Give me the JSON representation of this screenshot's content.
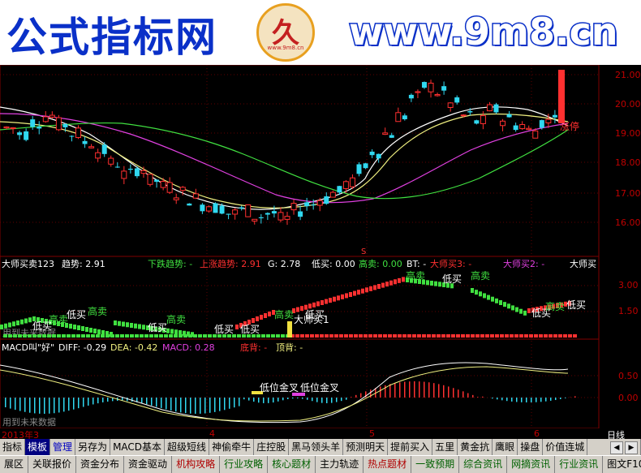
{
  "banner": {
    "title": "公式指标网",
    "url": "www.9m8.cn",
    "logo_char": "久",
    "logo_sub": "www.9m8.cn"
  },
  "price_axis": [
    "21.00",
    "20.00",
    "19.00",
    "18.00",
    "17.00",
    "16.00"
  ],
  "zhangting_label": "涨停",
  "s_marker": "S",
  "panel1": {
    "title": "大师买卖123",
    "trend": "趋势: 2.91",
    "down_trend": "下跌趋势: -",
    "up_trend": "上涨趋势: 2.91",
    "g": "G: 2.78",
    "low_buy": "低买: 0.00",
    "high_sell": "高卖: 0.00",
    "bt": "BT: -",
    "master_buy3": "大师买3: -",
    "master_buy2": "大师买2: -",
    "master_buy": "大师买",
    "axis": [
      "3.00",
      "1.50"
    ],
    "watermark": "用到未来数据",
    "labels": [
      "高卖",
      "低买",
      "高卖",
      "低买",
      "高卖",
      "低买",
      "低买",
      "低买",
      "高卖",
      "大师买1",
      "低买",
      "高卖",
      "低买",
      "高卖",
      "低买",
      "高卖",
      "低买"
    ]
  },
  "panel2": {
    "title": "MACD叫\"好\"",
    "diff": "DIFF: -0.29",
    "dea": "DEA: -0.42",
    "macd": "MACD: 0.28",
    "bottom_div": "底背: -",
    "top_div": "顶背: -",
    "axis": [
      "0.50",
      "0.00"
    ],
    "watermark": "用到未来数据",
    "label_low_gold": "低位金叉",
    "label_low_gold2": "低位金叉"
  },
  "date_axis": [
    "2013年3",
    "4",
    "5",
    "6"
  ],
  "date_axis_right": "日线",
  "tabs": [
    "指标",
    "模板",
    "管理",
    "另存为",
    "MACD基本",
    "超级短线",
    "神偷牵牛",
    "庄控股",
    "黑马领头羊",
    "预测明天",
    "提前买入",
    "五里",
    "黄金抗",
    "鹰眼",
    "操盘",
    "价值连城"
  ],
  "bottom_tabs": [
    "展区",
    "关联报价",
    "资金分布",
    "资金驱动",
    "机构攻略",
    "行业攻略",
    "核心题材",
    "主力轨迹",
    "热点题材",
    "一致预期",
    "综合资讯",
    "网摘资讯",
    "行业资讯",
    "图文F10"
  ],
  "colors": {
    "up": "#ff3030",
    "down": "#30d8f0",
    "ma_white": "#ffffff",
    "ma_yellow": "#f0f080",
    "ma_magenta": "#e040e0",
    "ma_green": "#40e040",
    "grid": "#800000"
  }
}
